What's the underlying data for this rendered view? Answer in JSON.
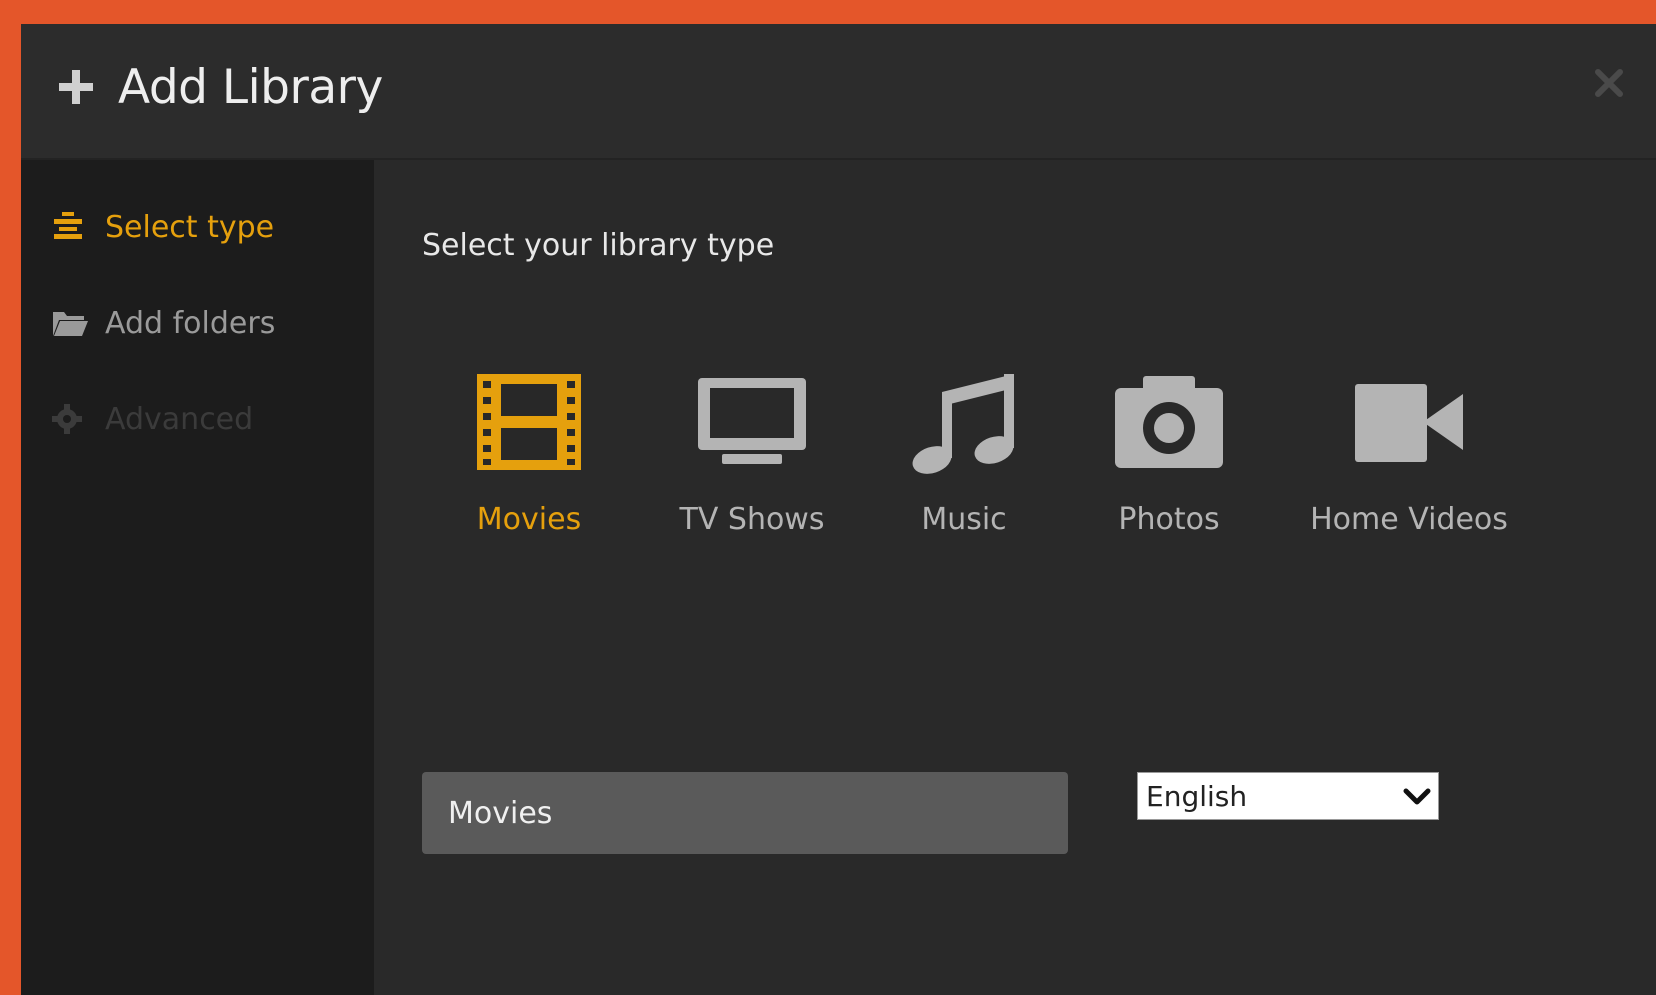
{
  "dialog": {
    "title": "Add Library",
    "icons": {
      "add": "plus-icon",
      "close": "close-icon"
    }
  },
  "sidebar": {
    "items": [
      {
        "label": "Select type",
        "icon": "list-icon",
        "state": "active"
      },
      {
        "label": "Add folders",
        "icon": "folder-icon",
        "state": "normal"
      },
      {
        "label": "Advanced",
        "icon": "gear-icon",
        "state": "disabled"
      }
    ]
  },
  "main": {
    "heading": "Select your library type",
    "types": [
      {
        "label": "Movies",
        "icon": "film-icon",
        "selected": true
      },
      {
        "label": "TV Shows",
        "icon": "tv-icon",
        "selected": false
      },
      {
        "label": "Music",
        "icon": "music-note-icon",
        "selected": false
      },
      {
        "label": "Photos",
        "icon": "camera-icon",
        "selected": false
      },
      {
        "label": "Home Videos",
        "icon": "video-camera-icon",
        "selected": false
      }
    ],
    "library_name": "Movies",
    "language": "English"
  },
  "colors": {
    "accent": "#e5a00d",
    "frame": "#e4562a",
    "dialog_bg": "#282828",
    "sidebar_bg": "#1c1c1c",
    "icon_gray": "#b4b4b4"
  }
}
